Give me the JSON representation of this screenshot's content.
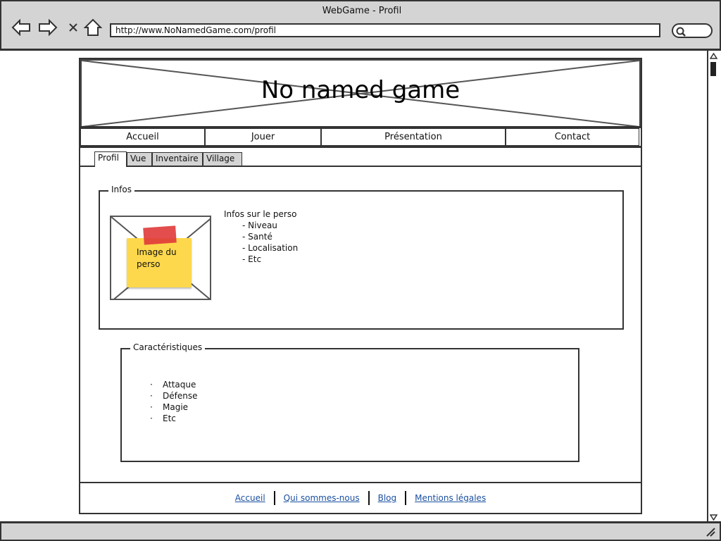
{
  "window": {
    "title": "WebGame - Profil",
    "url": "http://www.NoNamedGame.com/profil"
  },
  "banner": {
    "title": "No named game"
  },
  "main_nav": {
    "items": [
      "Accueil",
      "Jouer",
      "Présentation",
      "Contact"
    ]
  },
  "tabs": {
    "items": [
      "Profil",
      "Vue",
      "Inventaire",
      "Village"
    ],
    "active": "Profil"
  },
  "infos": {
    "legend": "Infos",
    "image_note": {
      "line1": "Image du",
      "line2": "perso"
    },
    "heading": "Infos sur le perso",
    "items": [
      "Niveau",
      "Santé",
      "Localisation",
      "Etc"
    ]
  },
  "characteristics": {
    "legend": "Caractéristiques",
    "items": [
      "Attaque",
      "Défense",
      "Magie",
      "Etc"
    ]
  },
  "footer": {
    "links": [
      "Accueil",
      "Qui sommes-nous",
      "Blog",
      "Mentions légales"
    ]
  },
  "colors": {
    "chrome": "#d4d4d4",
    "sticky_note": "#fdd84c",
    "tape": "#e03a3a",
    "link": "#1a4fa0"
  }
}
